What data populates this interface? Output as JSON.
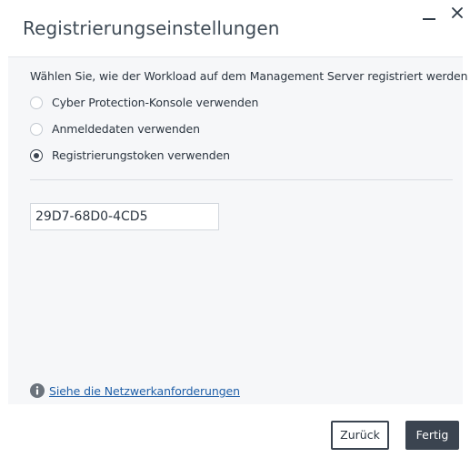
{
  "dialog": {
    "title": "Registrierungseinstellungen",
    "minimize_icon": "minimize-icon",
    "close_icon": "close-icon"
  },
  "content": {
    "intro": "Wählen Sie, wie der Workload auf dem Management Server registriert werden",
    "options": [
      {
        "label": "Cyber Protection-Konsole verwenden",
        "checked": false
      },
      {
        "label": "Anmeldedaten verwenden",
        "checked": false
      },
      {
        "label": "Registrierungstoken verwenden",
        "checked": true
      }
    ],
    "token": {
      "value": "29D7-68D0-4CD5",
      "placeholder": ""
    },
    "info": {
      "icon": "info-icon",
      "link_label": "Siehe die Netzwerkanforderungen"
    }
  },
  "footer": {
    "back_label": "Zurück",
    "finish_label": "Fertig"
  },
  "colors": {
    "accent": "#3b4450",
    "link": "#1f5fa8",
    "panel_bg": "#f6f7f9"
  }
}
